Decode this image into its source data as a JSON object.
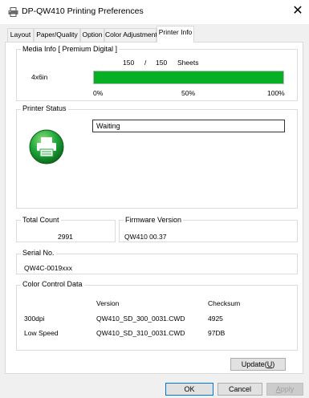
{
  "window": {
    "title": "DP-QW410 Printing Preferences",
    "close_glyph": "✕",
    "icon": "printer-icon"
  },
  "tabs": [
    {
      "label": "Layout",
      "active": false
    },
    {
      "label": "Paper/Quality",
      "active": false
    },
    {
      "label": "Option",
      "active": false
    },
    {
      "label": "Color Adjustment",
      "active": false
    },
    {
      "label": "Printer Info",
      "active": true
    }
  ],
  "media_info": {
    "legend": "Media Info [ Premium Digital ]",
    "count_remaining": "150",
    "separator": "/",
    "count_total": "150",
    "unit": "Sheets",
    "size": "4x6in",
    "progress_fraction": 1.0,
    "scale_labels": [
      "0%",
      "50%",
      "100%"
    ],
    "bar_color": "#06b025"
  },
  "printer_status": {
    "legend": "Printer Status",
    "status_text": "Waiting",
    "icon": "printer-ready-icon",
    "icon_color": "#1fa83a"
  },
  "total_count": {
    "legend": "Total Count",
    "value": "2991"
  },
  "firmware": {
    "legend": "Firmware Version",
    "value": "QW410 00.37"
  },
  "serial": {
    "legend": "Serial No.",
    "value": "QW4C-0019xxx"
  },
  "color_control": {
    "legend": "Color Control Data",
    "headers": [
      "Version",
      "Checksum"
    ],
    "rows": [
      {
        "label": "300dpi",
        "version": "QW410_SD_300_0031.CWD",
        "checksum": "4925"
      },
      {
        "label": "Low Speed",
        "version": "QW410_SD_310_0031.CWD",
        "checksum": "97DB"
      }
    ]
  },
  "buttons": {
    "update_prefix": "Update(",
    "update_accel": "U",
    "update_suffix": ")",
    "ok": "OK",
    "cancel": "Cancel",
    "apply_accel": "A",
    "apply_rest": "pply"
  }
}
